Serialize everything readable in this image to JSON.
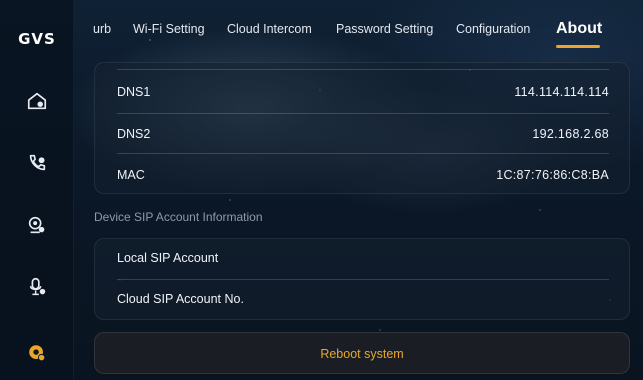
{
  "app": {
    "logo": "GVS"
  },
  "tabs": [
    {
      "label": "urb",
      "active": false
    },
    {
      "label": "Wi-Fi Setting",
      "active": false
    },
    {
      "label": "Cloud Intercom",
      "active": false
    },
    {
      "label": "Password Setting",
      "active": false
    },
    {
      "label": "Configuration",
      "active": false
    },
    {
      "label": "About",
      "active": true
    }
  ],
  "sidebar": {
    "items": [
      {
        "icon": "home-icon",
        "active": false
      },
      {
        "icon": "phone-icon",
        "active": false
      },
      {
        "icon": "monitor-camera-icon",
        "active": false
      },
      {
        "icon": "microphone-icon",
        "active": false
      },
      {
        "icon": "settings-gear-icon",
        "active": true
      }
    ]
  },
  "network": {
    "rows": [
      {
        "label": "DNS1",
        "value": "114.114.114.114"
      },
      {
        "label": "DNS2",
        "value": "192.168.2.68"
      },
      {
        "label": "MAC",
        "value": "1C:87:76:86:C8:BA"
      }
    ]
  },
  "sip": {
    "section_title": "Device SIP Account Information",
    "rows": [
      {
        "label": "Local SIP Account",
        "value": ""
      },
      {
        "label": "Cloud SIP Account No.",
        "value": ""
      }
    ]
  },
  "actions": {
    "reboot_label": "Reboot system"
  },
  "colors": {
    "accent": "#e9a62a",
    "text": "#f0f3f7",
    "muted": "#8f9aa8"
  }
}
